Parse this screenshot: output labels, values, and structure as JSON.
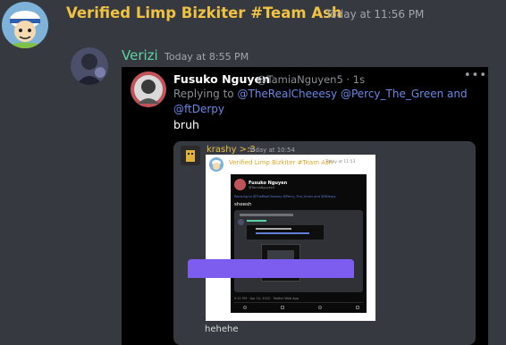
{
  "message1": {
    "author": "Verified Limp Bizkiter #Team Ash",
    "timestamp": "Today at 11:56 PM"
  },
  "message2": {
    "author": "Verizi",
    "timestamp": "Today at 8:55 PM"
  },
  "tweet": {
    "display_name": "Fusuko Nguyen",
    "handle": "@TamiaNguyen5 · 1s",
    "replying_prefix": "Replying to",
    "mentions_line1": "@TheRealCheeesy @Percy_The_Green and",
    "mentions_line2": "@ftDerpy",
    "text": "bruh",
    "more_label": "•••"
  },
  "nested_card": {
    "author": "krashy >:3",
    "timestamp": "Today at 10:54",
    "text": "hehehe",
    "inner_author": "Verified Limp Bizkiter #Team Ash",
    "inner_timestamp": "Today at 11:53",
    "inner_tweet": {
      "display_name": "Fusuko Nguyen",
      "handle": "@TamiaNguyen5",
      "reply_line": "Replying to @TheRealCheeesy @Percy_The_Green and @ftDerpy",
      "text": "sheesh",
      "footer": "9:21 PM · Apr 10, 2022 · Twitter Web App"
    }
  },
  "colors": {
    "background": "#36393f",
    "author1": "#f0c244",
    "author2": "#5ed3a4",
    "mention": "#6a8ae6",
    "accent_purple": "#7d5df0"
  }
}
